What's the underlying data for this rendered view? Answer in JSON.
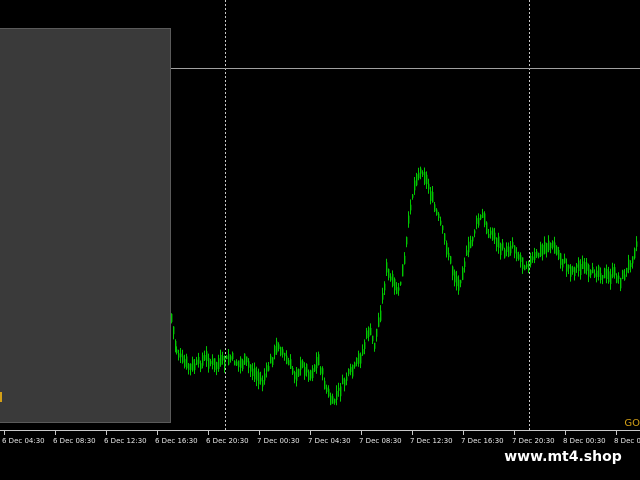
{
  "time_axis": {
    "labels": [
      "6 Dec 04:30",
      "6 Dec 08:30",
      "6 Dec 12:30",
      "6 Dec 16:30",
      "6 Dec 20:30",
      "7 Dec 00:30",
      "7 Dec 04:30",
      "7 Dec 08:30",
      "7 Dec 12:30",
      "7 Dec 16:30",
      "7 Dec 20:30",
      "8 Dec 00:30",
      "8 Dec 04:30",
      "8"
    ]
  },
  "symbol_label": "GO",
  "watermark": "www.mt4.shop",
  "colors": {
    "background": "#000000",
    "candles": "#00c800",
    "grid": "#c8c8c8",
    "axis_text": "#e6e6e6",
    "panel": "#3a3a3a",
    "symbol_text": "#d4a017"
  },
  "chart_data": {
    "type": "candlestick",
    "timeframe_step_minutes": 30,
    "session_separators": [
      "7 Dec 00:30",
      "8 Dec 00:30"
    ],
    "horizontal_line_visible": true,
    "grid": false,
    "price_scale_visible": false
  }
}
